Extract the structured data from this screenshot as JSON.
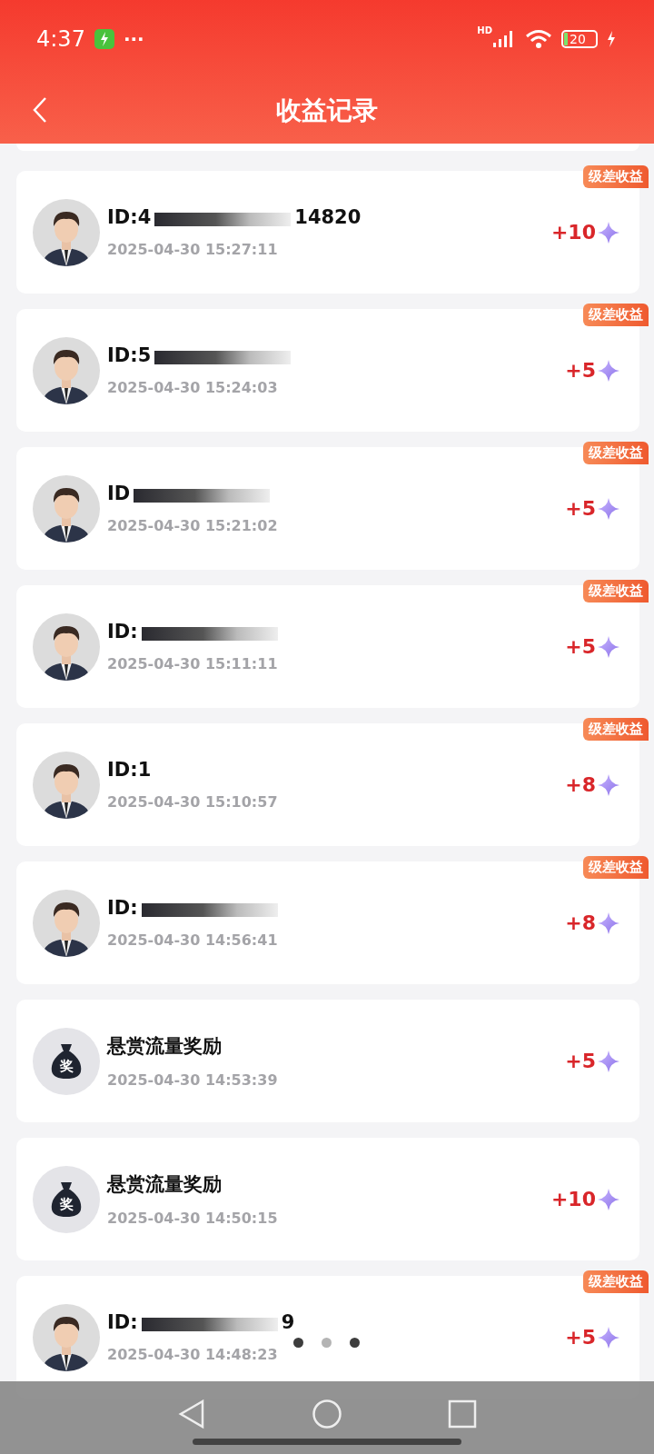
{
  "status_bar": {
    "time": "4:37",
    "more": "···",
    "network": "HD",
    "battery": "20"
  },
  "header": {
    "title": "收益记录"
  },
  "records": [
    {
      "kind": "member",
      "id_head": "ID:4",
      "id_tail": "14820",
      "redacted": true,
      "time": "2025-04-30 15:27:11",
      "amount": "+10",
      "tag": "级差收益"
    },
    {
      "kind": "member",
      "id_head": "ID:5",
      "redacted": true,
      "time": "2025-04-30 15:24:03",
      "amount": "+5",
      "tag": "级差收益"
    },
    {
      "kind": "member",
      "id_head": "ID",
      "redacted": true,
      "time": "2025-04-30 15:21:02",
      "amount": "+5",
      "tag": "级差收益"
    },
    {
      "kind": "member",
      "id_head": "ID:",
      "redacted": true,
      "time": "2025-04-30 15:11:11",
      "amount": "+5",
      "tag": "级差收益"
    },
    {
      "kind": "member",
      "id_head": "ID:1",
      "redacted": false,
      "time": "2025-04-30 15:10:57",
      "amount": "+8",
      "tag": "级差收益"
    },
    {
      "kind": "member",
      "id_head": "ID:",
      "redacted": true,
      "time": "2025-04-30 14:56:41",
      "amount": "+8",
      "tag": "级差收益"
    },
    {
      "kind": "reward",
      "title": "悬赏流量奖励",
      "icon_text": "奖",
      "time": "2025-04-30 14:53:39",
      "amount": "+5"
    },
    {
      "kind": "reward",
      "title": "悬赏流量奖励",
      "icon_text": "奖",
      "time": "2025-04-30 14:50:15",
      "amount": "+10"
    },
    {
      "kind": "member",
      "id_head": "ID:",
      "id_tail": "9",
      "redacted": true,
      "time": "2025-04-30 14:48:23",
      "amount": "+5",
      "tag": "级差收益"
    }
  ],
  "pager": [
    {
      "selected": false
    },
    {
      "selected": true
    },
    {
      "selected": false
    }
  ]
}
